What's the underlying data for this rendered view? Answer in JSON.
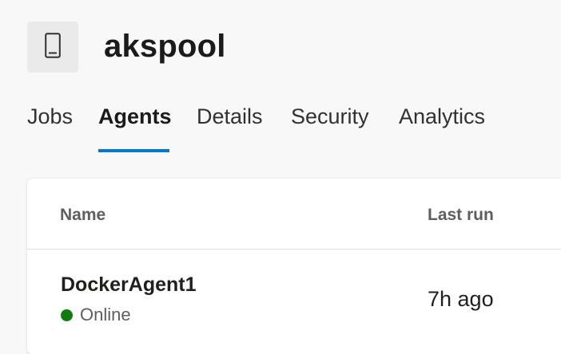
{
  "pool": {
    "name": "akspool",
    "icon": "phone-agent-icon"
  },
  "tabs": [
    {
      "label": "Jobs",
      "active": false
    },
    {
      "label": "Agents",
      "active": true
    },
    {
      "label": "Details",
      "active": false
    },
    {
      "label": "Security",
      "active": false
    },
    {
      "label": "Analytics",
      "active": false
    }
  ],
  "table": {
    "columns": {
      "name": "Name",
      "last_run": "Last run"
    },
    "rows": [
      {
        "name": "DockerAgent1",
        "status": "Online",
        "status_color": "#107c10",
        "last_run": "7h ago"
      }
    ]
  },
  "colors": {
    "accent": "#0078d4",
    "background": "#f8f8f8"
  }
}
